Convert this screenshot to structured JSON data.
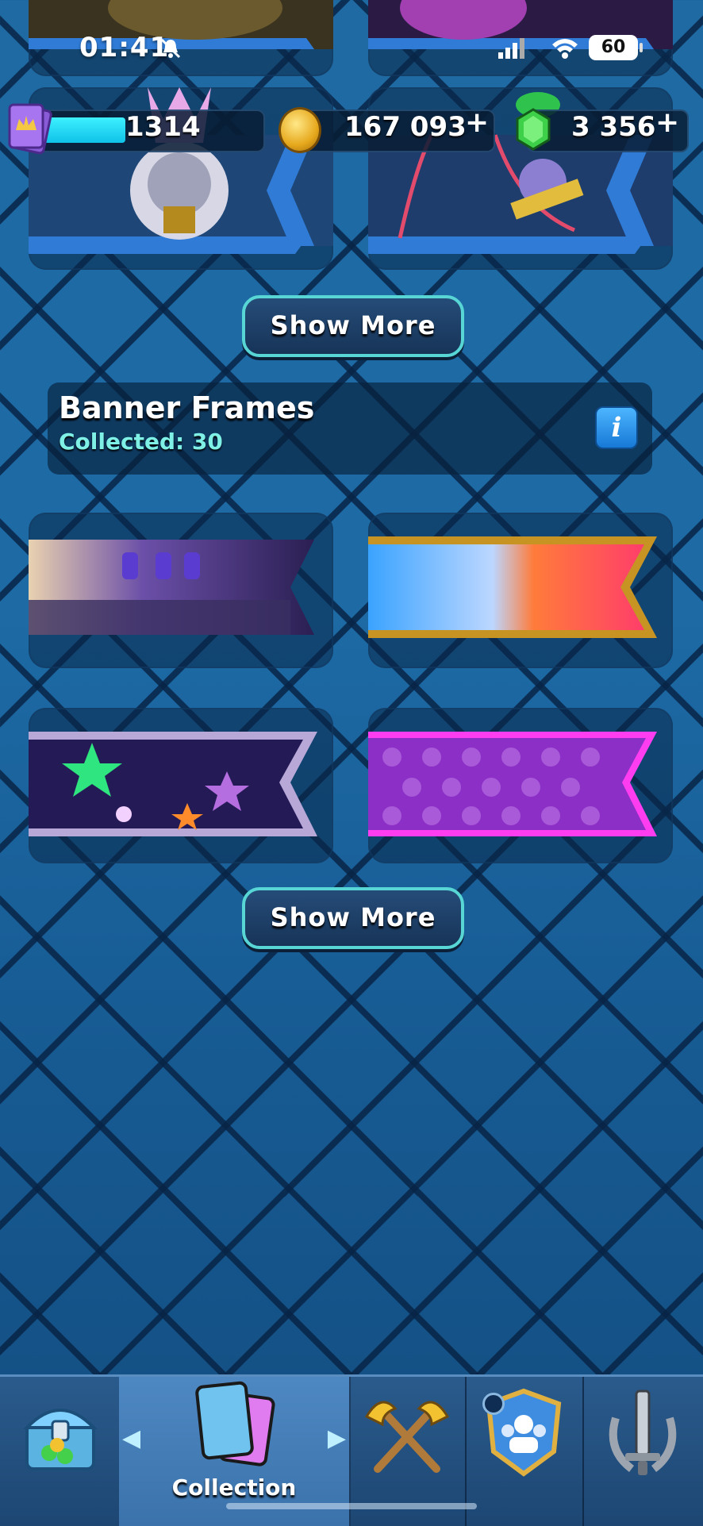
{
  "status_bar": {
    "time": "01:41",
    "battery": "60"
  },
  "resources": {
    "xp_value": "1314",
    "gold": "167 093",
    "gold_plus": "+",
    "gems": "3 356",
    "gems_plus": "+",
    "xp_progress": 0.45
  },
  "show_more_label": "Show More",
  "banner_frames": {
    "title": "Banner Frames",
    "collected": "Collected: 30",
    "info_label": "i"
  },
  "nav": {
    "items": [
      {
        "name": "Shop",
        "icon": "treasure-chest-icon"
      },
      {
        "name": "Collection",
        "label": "Collection",
        "icon": "cards-icon"
      },
      {
        "name": "Battle",
        "icon": "crossed-axes-icon"
      },
      {
        "name": "Clan",
        "icon": "clan-shield-icon"
      },
      {
        "name": "Events",
        "icon": "sword-laurel-icon"
      }
    ]
  },
  "colors": {
    "accent_teal": "#58d6d6",
    "collected_text": "#7ef0e6",
    "xp_fill": "#3ef0ff",
    "background": "#1a5d93"
  }
}
